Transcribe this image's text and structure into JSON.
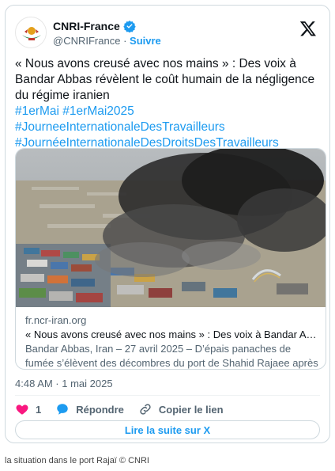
{
  "author": {
    "name": "CNRI-France",
    "handle": "@CNRIFrance",
    "separator": "·",
    "follow_label": "Suivre"
  },
  "tweet": {
    "text": "« Nous avons creusé avec nos mains » : Des voix à Bandar Abbas révèlent le coût humain de la négligence du régime iranien",
    "hashtags": [
      "#1erMai #1erMai2025",
      "#JourneeInternationaleDesTravailleurs",
      "#JournéeInternationaleDesDroitsDesTravailleurs"
    ]
  },
  "link_card": {
    "domain": "fr.ncr-iran.org",
    "title": "« Nous avons creusé avec nos mains » : Des voix à Bandar Abbas rév...",
    "description": "Bandar Abbas, Iran – 27 avril 2025 – D’épais panaches de fumée s’élèvent des décombres du port de Shahid Rajaee après une explosio..."
  },
  "timestamp": "4:48 AM · 1 mai 2025",
  "actions": {
    "like_count": "1",
    "reply_label": "Répondre",
    "copy_label": "Copier le lien"
  },
  "read_more_label": "Lire la suite sur X",
  "caption": "la situation dans le port Rajaï © CNRI",
  "colors": {
    "accent": "#1d9bf0",
    "like": "#f91880",
    "secondary_text": "#536471",
    "border": "#cfd9de"
  },
  "icons": [
    "ncri-logo-icon",
    "verified-badge-icon",
    "x-logo-icon",
    "heart-icon",
    "reply-bubble-icon",
    "link-icon"
  ]
}
